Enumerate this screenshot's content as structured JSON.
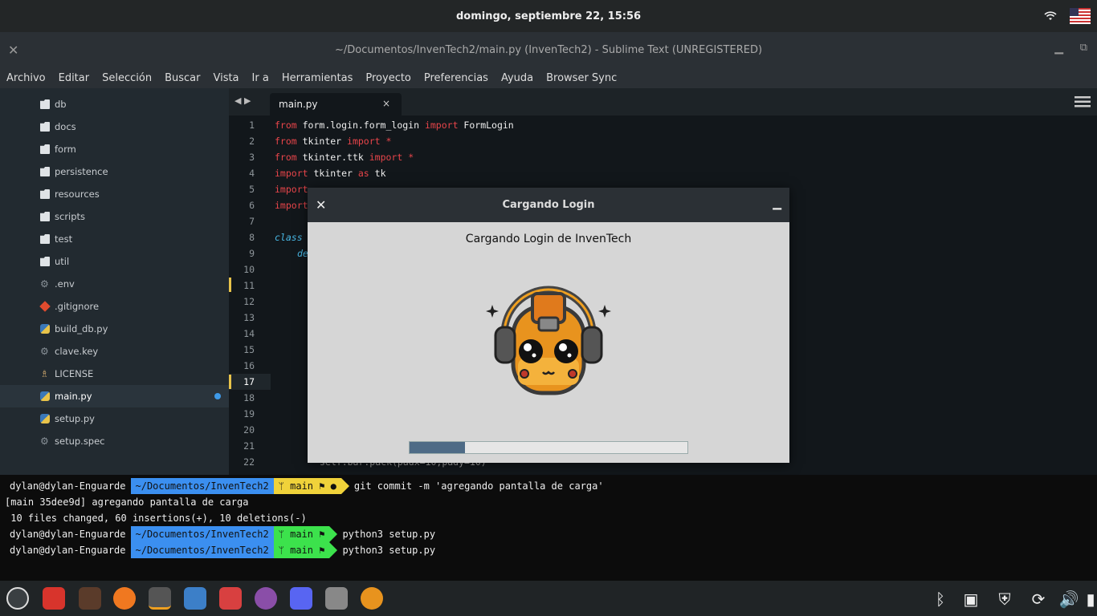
{
  "topbar": {
    "clock": "domingo, septiembre 22, 15:56"
  },
  "window": {
    "title": "~/Documentos/InvenTech2/main.py (InvenTech2) - Sublime Text (UNREGISTERED)"
  },
  "menu": [
    "Archivo",
    "Editar",
    "Selección",
    "Buscar",
    "Vista",
    "Ir a",
    "Herramientas",
    "Proyecto",
    "Preferencias",
    "Ayuda",
    "Browser Sync"
  ],
  "sidebar": {
    "items": [
      {
        "label": "db",
        "icon": "folder-icon"
      },
      {
        "label": "docs",
        "icon": "folder-icon"
      },
      {
        "label": "form",
        "icon": "folder-icon"
      },
      {
        "label": "persistence",
        "icon": "folder-icon"
      },
      {
        "label": "resources",
        "icon": "folder-icon"
      },
      {
        "label": "scripts",
        "icon": "folder-icon"
      },
      {
        "label": "test",
        "icon": "folder-icon"
      },
      {
        "label": "util",
        "icon": "folder-icon"
      },
      {
        "label": ".env",
        "icon": "gear-icon"
      },
      {
        "label": ".gitignore",
        "icon": "git-icon"
      },
      {
        "label": "build_db.py",
        "icon": "python-icon"
      },
      {
        "label": "clave.key",
        "icon": "gear-icon"
      },
      {
        "label": "LICENSE",
        "icon": "license-icon"
      },
      {
        "label": "main.py",
        "icon": "python-icon"
      },
      {
        "label": "setup.py",
        "icon": "python-icon"
      },
      {
        "label": "setup.spec",
        "icon": "gear-icon"
      }
    ]
  },
  "tab": {
    "label": "main.py",
    "close": "×"
  },
  "editor": {
    "line_numbers": [
      "1",
      "2",
      "3",
      "4",
      "5",
      "6",
      "7",
      "8",
      "9",
      "10",
      "11",
      "12",
      "13",
      "14",
      "15",
      "16",
      "17",
      "18",
      "19",
      "20",
      "21",
      "22"
    ],
    "lines": [
      {
        "k1": "from",
        "m1": " form.login.form_login ",
        "k2": "import",
        "m2": " FormLogin"
      },
      {
        "k1": "from",
        "m1": " tkinter ",
        "k2": "import",
        "m2": " *"
      },
      {
        "k1": "from",
        "m1": " tkinter.ttk ",
        "k2": "import",
        "m2": " *"
      },
      {
        "k1": "import",
        "m1": " tkinter ",
        "k2": "as",
        "m2": " tk"
      },
      {
        "k1": "import",
        "m1": "",
        "k2": "",
        "m2": ""
      },
      {
        "k1": "import",
        "m1": "",
        "k2": "",
        "m2": ""
      }
    ],
    "line8": "class",
    "line9": "de",
    "line22": "self.bar.pack(padx=10,pady=10)"
  },
  "dialog": {
    "title": "Cargando Login",
    "label": "Cargando Login de InvenTech",
    "progress": 0.2
  },
  "terminal": {
    "user": "dylan@dylan-Enguarde",
    "path": "~/Documentos/InvenTech2",
    "branch": "ᛘ main ⚑ ●",
    "branch2": "ᛘ main ⚑",
    "cmd1": "git commit -m 'agregando pantalla de carga'",
    "out1": "[main 35dee9d] agregando pantalla de carga",
    "out2": " 10 files changed, 60 insertions(+), 10 deletions(-)",
    "cmd2": "python3 setup.py",
    "cmd3": "python3 setup.py"
  },
  "colors": {
    "path": "#3b8ff0",
    "git_dirty": "#f0d23a",
    "git_clean": "#3ce24c",
    "keyword": "#e8454a"
  }
}
